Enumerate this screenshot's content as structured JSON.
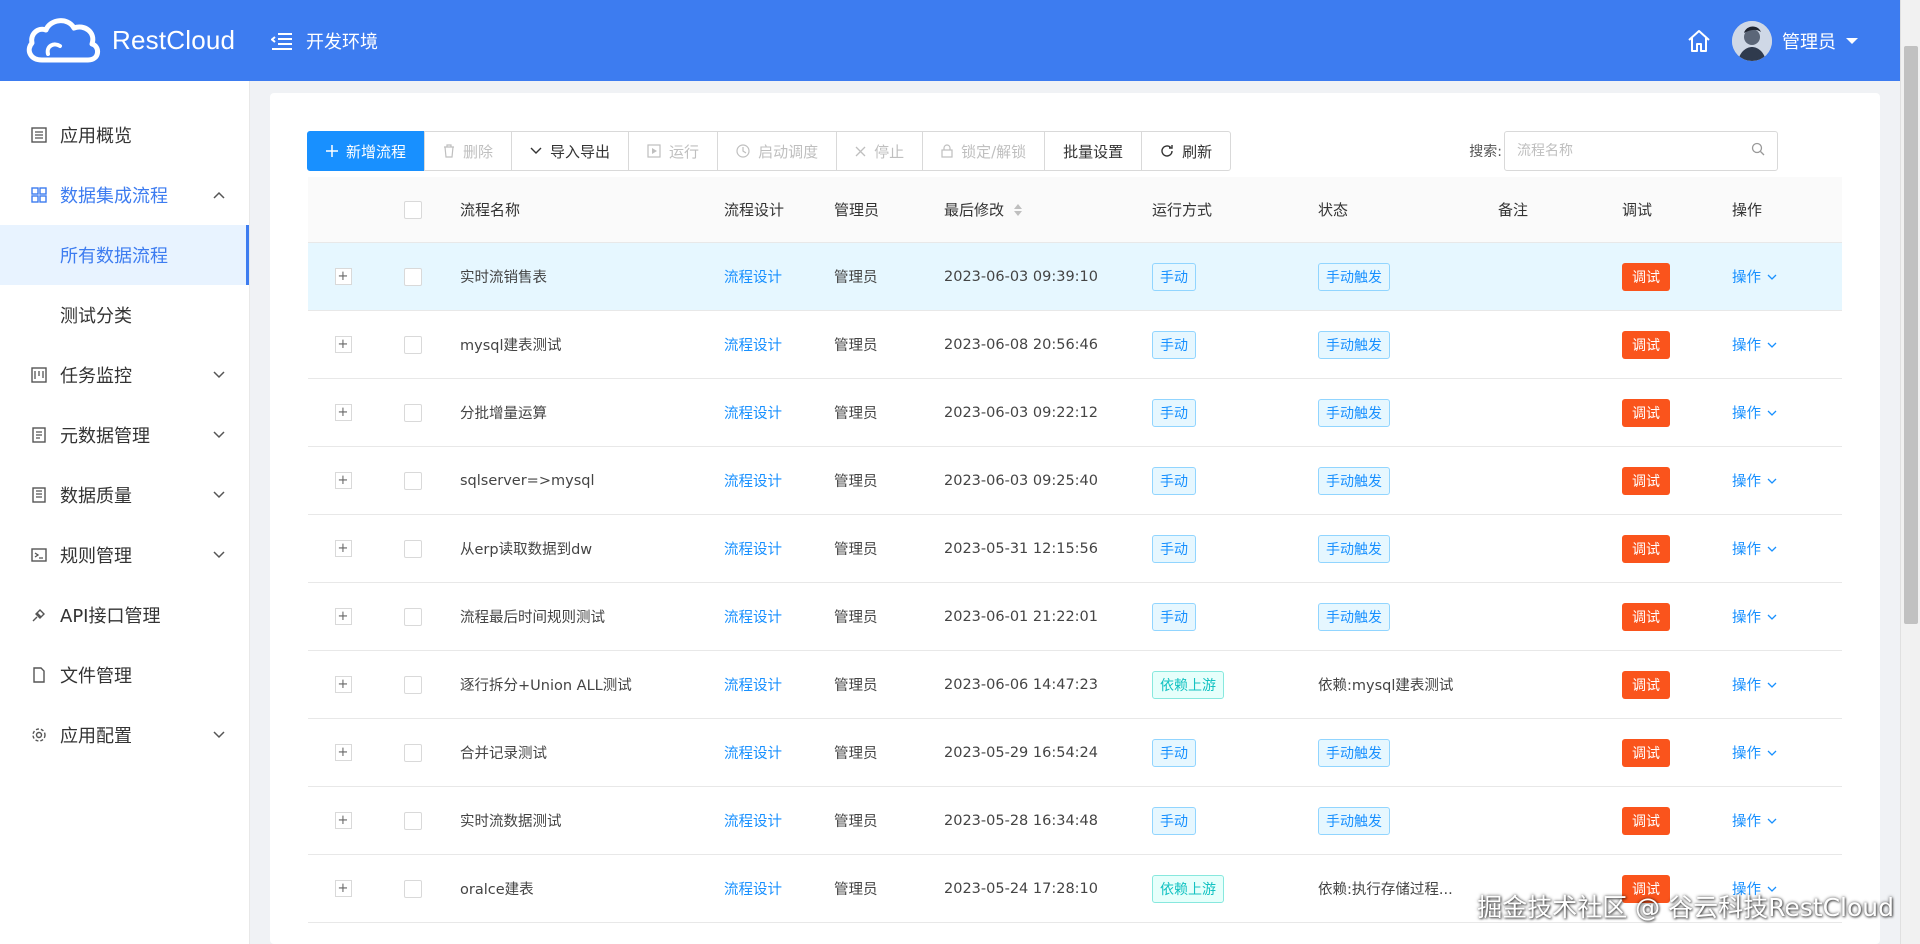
{
  "header": {
    "brand": "RestCloud",
    "env": "开发环境",
    "user": "管理员"
  },
  "sidebar": {
    "items": [
      {
        "label": "应用概览",
        "icon": "list-icon"
      },
      {
        "label": "数据集成流程",
        "icon": "grid-icon",
        "expanded": true,
        "children": [
          {
            "label": "所有数据流程",
            "selected": true
          },
          {
            "label": "测试分类"
          }
        ]
      },
      {
        "label": "任务监控",
        "icon": "monitor-icon"
      },
      {
        "label": "元数据管理",
        "icon": "metadata-icon"
      },
      {
        "label": "数据质量",
        "icon": "quality-icon"
      },
      {
        "label": "规则管理",
        "icon": "terminal-icon"
      },
      {
        "label": "API接口管理",
        "icon": "plug-icon"
      },
      {
        "label": "文件管理",
        "icon": "file-icon"
      },
      {
        "label": "应用配置",
        "icon": "gear-icon"
      }
    ]
  },
  "toolbar": {
    "add": "新增流程",
    "delete": "删除",
    "import_export": "导入导出",
    "run": "运行",
    "schedule": "启动调度",
    "stop": "停止",
    "lock": "锁定/解锁",
    "batch": "批量设置",
    "refresh": "刷新"
  },
  "search": {
    "label": "搜索:",
    "placeholder": "流程名称"
  },
  "table": {
    "columns": {
      "name": "流程名称",
      "design": "流程设计",
      "admin": "管理员",
      "modified": "最后修改",
      "run_mode": "运行方式",
      "status": "状态",
      "note": "备注",
      "debug": "调试",
      "op": "操作"
    },
    "rows": [
      {
        "name": "实时流销售表",
        "design": "流程设计",
        "admin": "管理员",
        "modified": "2023-06-03 09:39:10",
        "run_mode": "手动",
        "status": "手动触发",
        "debug": "调试",
        "op": "操作"
      },
      {
        "name": "mysql建表测试",
        "design": "流程设计",
        "admin": "管理员",
        "modified": "2023-06-08 20:56:46",
        "run_mode": "手动",
        "status": "手动触发",
        "debug": "调试",
        "op": "操作"
      },
      {
        "name": "分批增量运算",
        "design": "流程设计",
        "admin": "管理员",
        "modified": "2023-06-03 09:22:12",
        "run_mode": "手动",
        "status": "手动触发",
        "debug": "调试",
        "op": "操作"
      },
      {
        "name": "sqlserver=>mysql",
        "design": "流程设计",
        "admin": "管理员",
        "modified": "2023-06-03 09:25:40",
        "run_mode": "手动",
        "status": "手动触发",
        "debug": "调试",
        "op": "操作"
      },
      {
        "name": "从erp读取数据到dw",
        "design": "流程设计",
        "admin": "管理员",
        "modified": "2023-05-31 12:15:56",
        "run_mode": "手动",
        "status": "手动触发",
        "debug": "调试",
        "op": "操作"
      },
      {
        "name": "流程最后时间规则测试",
        "design": "流程设计",
        "admin": "管理员",
        "modified": "2023-06-01 21:22:01",
        "run_mode": "手动",
        "status": "手动触发",
        "debug": "调试",
        "op": "操作"
      },
      {
        "name": "逐行拆分+Union ALL测试",
        "design": "流程设计",
        "admin": "管理员",
        "modified": "2023-06-06 14:47:23",
        "run_mode": "依赖上游",
        "status": "依赖:mysql建表测试",
        "debug": "调试",
        "op": "操作"
      },
      {
        "name": "合并记录测试",
        "design": "流程设计",
        "admin": "管理员",
        "modified": "2023-05-29 16:54:24",
        "run_mode": "手动",
        "status": "手动触发",
        "debug": "调试",
        "op": "操作"
      },
      {
        "name": "实时流数据测试",
        "design": "流程设计",
        "admin": "管理员",
        "modified": "2023-05-28 16:34:48",
        "run_mode": "手动",
        "status": "手动触发",
        "debug": "调试",
        "op": "操作"
      },
      {
        "name": "oralce建表",
        "design": "流程设计",
        "admin": "管理员",
        "modified": "2023-05-24 17:28:10",
        "run_mode": "依赖上游",
        "status": "依赖:执行存储过程...",
        "debug": "调试",
        "op": "操作"
      }
    ]
  },
  "watermark": "掘金技术社区 @ 谷云科技RestCloud",
  "colors": {
    "header_bg": "#3d7cf0",
    "primary": "#1890ff",
    "debug": "#fa541c",
    "tag_cyan": "#13c2c2"
  }
}
